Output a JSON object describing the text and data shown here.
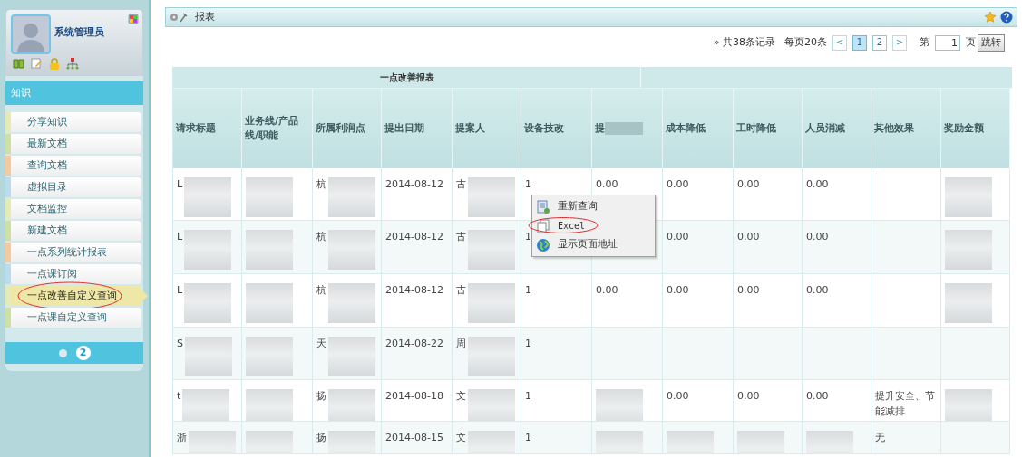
{
  "sidebar": {
    "user_name": "系统管理员",
    "section": "知识",
    "items": [
      {
        "label": "分享知识",
        "color": "#e4ebb8",
        "selected": false
      },
      {
        "label": "最新文档",
        "color": "#cfe0a6",
        "selected": false
      },
      {
        "label": "查询文档",
        "color": "#f5c9a0",
        "selected": false
      },
      {
        "label": "虚拟目录",
        "color": "#b9dcef",
        "selected": false
      },
      {
        "label": "文档监控",
        "color": "#e4ebb8",
        "selected": false
      },
      {
        "label": "新建文档",
        "color": "#cfe0a6",
        "selected": false
      },
      {
        "label": "一点系列统计报表",
        "color": "#f5c9a0",
        "selected": false
      },
      {
        "label": "一点课订阅",
        "color": "#b9dcef",
        "selected": false
      },
      {
        "label": "一点改善自定义查询",
        "color": "#e4ebb8",
        "selected": true
      },
      {
        "label": "一点课自定义查询",
        "color": "#cfe0a6",
        "selected": false
      }
    ],
    "pages": [
      {
        "selected": false
      },
      {
        "label": "2",
        "selected": true
      }
    ]
  },
  "header": {
    "title": "报表"
  },
  "pagination": {
    "summary": "» 共38条记录",
    "per_page": "每页20条",
    "prev": "<",
    "pages": [
      {
        "label": "1",
        "selected": true
      },
      {
        "label": "2",
        "selected": false
      }
    ],
    "next": ">",
    "goto_label": "第",
    "goto_value": "1",
    "goto_suffix": "页",
    "goto_button": "跳转"
  },
  "table": {
    "title": "一点改善报表",
    "columns": [
      {
        "kind": "text",
        "label": "请求标题"
      },
      {
        "kind": "text",
        "label": "业务线/产品线/职能"
      },
      {
        "kind": "text",
        "label": "所属利润点"
      },
      {
        "kind": "text",
        "label": "提出日期"
      },
      {
        "kind": "text",
        "label": "提案人"
      },
      {
        "kind": "text",
        "label": "设备技改"
      },
      {
        "kind": "redacted",
        "label": "提"
      },
      {
        "kind": "text",
        "label": "成本降低"
      },
      {
        "kind": "text",
        "label": "工时降低"
      },
      {
        "kind": "text",
        "label": "人员消减"
      },
      {
        "kind": "text",
        "label": "其他效果"
      },
      {
        "kind": "text",
        "label": "奖励金额"
      }
    ],
    "rows": [
      [
        {
          "kind": "redacted",
          "text": "L"
        },
        {
          "kind": "redacted"
        },
        {
          "kind": "redacted",
          "text": "杭"
        },
        {
          "kind": "text",
          "text": "2014-08-12"
        },
        {
          "kind": "redacted",
          "text": "古"
        },
        {
          "kind": "text",
          "text": "1"
        },
        {
          "kind": "text",
          "text": "0.00"
        },
        {
          "kind": "text",
          "text": "0.00"
        },
        {
          "kind": "text",
          "text": "0.00"
        },
        {
          "kind": "text",
          "text": "0.00"
        },
        {
          "kind": "empty"
        },
        {
          "kind": "redacted"
        }
      ],
      [
        {
          "kind": "redacted",
          "text": "L"
        },
        {
          "kind": "redacted"
        },
        {
          "kind": "redacted",
          "text": "杭"
        },
        {
          "kind": "text",
          "text": "2014-08-12"
        },
        {
          "kind": "redacted",
          "text": "古"
        },
        {
          "kind": "text",
          "text": "1"
        },
        {
          "kind": "empty"
        },
        {
          "kind": "text",
          "text": "0.00"
        },
        {
          "kind": "text",
          "text": "0.00"
        },
        {
          "kind": "text",
          "text": "0.00"
        },
        {
          "kind": "empty"
        },
        {
          "kind": "redacted"
        }
      ],
      [
        {
          "kind": "redacted",
          "text": "L"
        },
        {
          "kind": "redacted"
        },
        {
          "kind": "redacted",
          "text": "杭"
        },
        {
          "kind": "text",
          "text": "2014-08-12"
        },
        {
          "kind": "redacted",
          "text": "古"
        },
        {
          "kind": "text",
          "text": "1"
        },
        {
          "kind": "text",
          "text": "0.00"
        },
        {
          "kind": "text",
          "text": "0.00"
        },
        {
          "kind": "text",
          "text": "0.00"
        },
        {
          "kind": "text",
          "text": "0.00"
        },
        {
          "kind": "empty"
        },
        {
          "kind": "redacted"
        }
      ],
      [
        {
          "kind": "redacted",
          "text": "S"
        },
        {
          "kind": "redacted"
        },
        {
          "kind": "redacted",
          "text": "天"
        },
        {
          "kind": "text",
          "text": "2014-08-22"
        },
        {
          "kind": "redacted",
          "text": "周"
        },
        {
          "kind": "text",
          "text": "1"
        },
        {
          "kind": "empty"
        },
        {
          "kind": "empty"
        },
        {
          "kind": "empty"
        },
        {
          "kind": "empty"
        },
        {
          "kind": "empty"
        },
        {
          "kind": "empty"
        }
      ],
      [
        {
          "kind": "redacted",
          "text": "t"
        },
        {
          "kind": "redacted"
        },
        {
          "kind": "redacted",
          "text": "扬"
        },
        {
          "kind": "text",
          "text": "2014-08-18"
        },
        {
          "kind": "redacted",
          "text": "文"
        },
        {
          "kind": "text",
          "text": "1"
        },
        {
          "kind": "redacted"
        },
        {
          "kind": "text",
          "text": "0.00"
        },
        {
          "kind": "text",
          "text": "0.00"
        },
        {
          "kind": "text",
          "text": "0.00"
        },
        {
          "kind": "text",
          "text": "提升安全、节能减排"
        },
        {
          "kind": "redacted"
        }
      ],
      [
        {
          "kind": "redacted",
          "text": "浙"
        },
        {
          "kind": "redacted"
        },
        {
          "kind": "redacted",
          "text": "扬"
        },
        {
          "kind": "text",
          "text": "2014-08-15"
        },
        {
          "kind": "redacted",
          "text": "文"
        },
        {
          "kind": "text",
          "text": "1"
        },
        {
          "kind": "redacted"
        },
        {
          "kind": "redacted"
        },
        {
          "kind": "redacted"
        },
        {
          "kind": "redacted"
        },
        {
          "kind": "text",
          "text": "无"
        },
        {
          "kind": "empty"
        }
      ]
    ]
  },
  "context_menu": [
    {
      "kind": "refresh",
      "label": "重新查询",
      "circled": false
    },
    {
      "kind": "excel",
      "label": "Excel",
      "circled": true
    },
    {
      "kind": "globe",
      "label": "显示页面地址",
      "circled": false
    }
  ]
}
